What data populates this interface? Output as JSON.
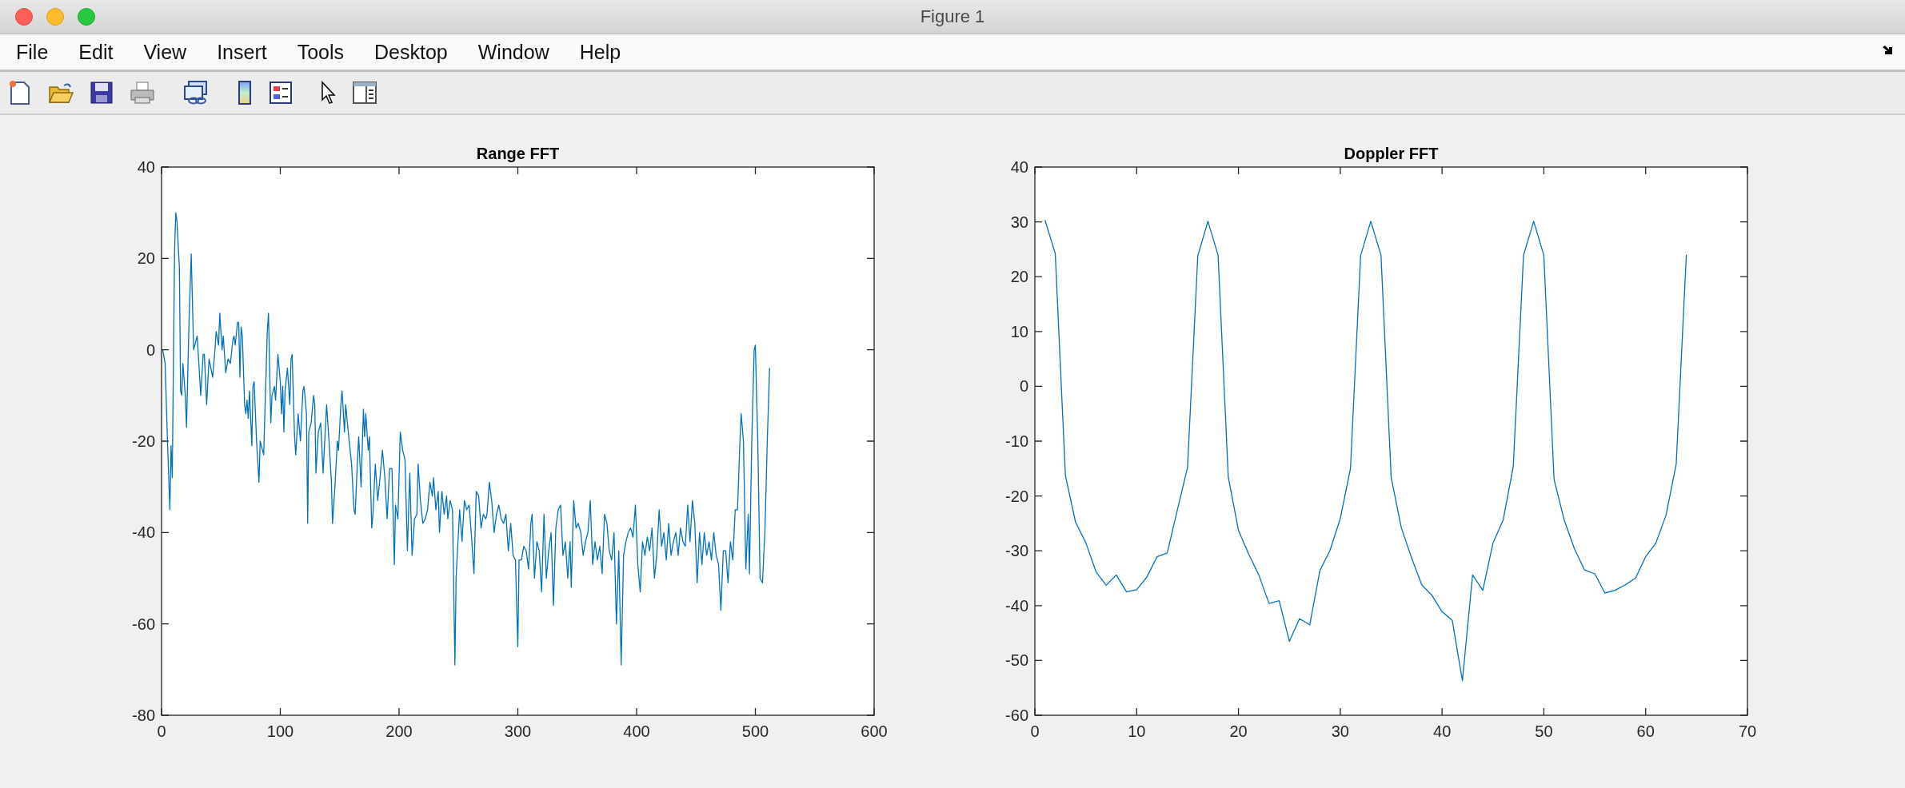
{
  "window": {
    "title": "Figure 1"
  },
  "menu": [
    "File",
    "Edit",
    "View",
    "Insert",
    "Tools",
    "Desktop",
    "Window",
    "Help"
  ],
  "toolbar": [
    {
      "kind": "new-file"
    },
    {
      "kind": "open"
    },
    {
      "kind": "save"
    },
    {
      "kind": "print"
    },
    {
      "kind": "link"
    },
    {
      "kind": "colorbar"
    },
    {
      "kind": "legend"
    },
    {
      "kind": "pointer"
    },
    {
      "kind": "panel"
    }
  ],
  "plots": [
    {
      "chart_data": {
        "type": "line",
        "title": "Range FFT",
        "xlim": [
          0,
          600
        ],
        "ylim": [
          -80,
          40
        ],
        "xticks": [
          0,
          100,
          200,
          300,
          400,
          500,
          600
        ],
        "yticks": [
          -80,
          -60,
          -40,
          -20,
          0,
          20,
          40
        ],
        "x": [
          1,
          3,
          5,
          7,
          8,
          9,
          11,
          12,
          13,
          15,
          16,
          17,
          18,
          20,
          21,
          23,
          25,
          27,
          29,
          30,
          33,
          35,
          36,
          38,
          40,
          43,
          45,
          46,
          48,
          49,
          51,
          52,
          54,
          56,
          58,
          60,
          61,
          62,
          64,
          65,
          66,
          67,
          68,
          70,
          71,
          72,
          73,
          74,
          76,
          77,
          78,
          80,
          82,
          83,
          85,
          86,
          89,
          90,
          92,
          93,
          95,
          96,
          98,
          100,
          101,
          102,
          103,
          104,
          106,
          108,
          109,
          110,
          112,
          113,
          115,
          117,
          119,
          120,
          122,
          123,
          124,
          126,
          128,
          129,
          130,
          132,
          134,
          136,
          138,
          139,
          141,
          143,
          144,
          146,
          148,
          149,
          151,
          152,
          154,
          155,
          158,
          160,
          162,
          163,
          165,
          166,
          168,
          170,
          171,
          172,
          174,
          175,
          177,
          178,
          180,
          182,
          184,
          186,
          188,
          190,
          192,
          194,
          196,
          197,
          199,
          201,
          203,
          205,
          207,
          209,
          211,
          213,
          215,
          216,
          218,
          220,
          222,
          224,
          226,
          228,
          229,
          231,
          233,
          234,
          236,
          238,
          240,
          241,
          243,
          245,
          247,
          248,
          251,
          253,
          255,
          257,
          259,
          261,
          263,
          265,
          267,
          269,
          271,
          273,
          274,
          276,
          278,
          280,
          282,
          284,
          286,
          288,
          290,
          292,
          294,
          296,
          298,
          300,
          301,
          303,
          305,
          307,
          309,
          311,
          312,
          314,
          316,
          318,
          320,
          322,
          324,
          326,
          328,
          330,
          332,
          334,
          336,
          338,
          340,
          342,
          344,
          345,
          347,
          349,
          351,
          353,
          355,
          357,
          359,
          361,
          363,
          365,
          367,
          369,
          371,
          373,
          375,
          377,
          379,
          381,
          383,
          385,
          387,
          389,
          391,
          393,
          395,
          397,
          399,
          401,
          403,
          405,
          407,
          409,
          411,
          413,
          415,
          417,
          419,
          421,
          423,
          425,
          427,
          429,
          431,
          433,
          435,
          437,
          439,
          441,
          443,
          445,
          447,
          449,
          451,
          453,
          455,
          457,
          459,
          461,
          463,
          465,
          467,
          469,
          471,
          473,
          475,
          477,
          479,
          481,
          483,
          485,
          487,
          488,
          490,
          492,
          494,
          495,
          497,
          499,
          500,
          502,
          504,
          506,
          508,
          510,
          512
        ],
        "series": [
          {
            "color": "#0072bd",
            "values": [
              0,
              -3,
              -20,
              -35,
              -21,
              -28,
              22,
              30,
              28,
              18,
              -9,
              -10,
              -3,
              -10,
              -17,
              5,
              21,
              0,
              2,
              3,
              -10,
              -1,
              -1,
              -12,
              -2,
              -6,
              0,
              4,
              1,
              8,
              0,
              3,
              -5,
              -2,
              -3,
              2,
              3,
              1,
              6,
              6,
              -6,
              5,
              3,
              -12,
              -14,
              -11,
              -15,
              -9,
              -21,
              -8,
              -7,
              -20,
              -29,
              -20,
              -22,
              -23,
              4,
              8,
              -16,
              -10,
              -8,
              -11,
              -1,
              -7,
              -14,
              -8,
              -18,
              -9,
              -4,
              -12,
              -2,
              -1,
              -19,
              -23,
              -14,
              -20,
              -9,
              -8,
              -14,
              -38,
              -18,
              -16,
              -10,
              -12,
              -27,
              -18,
              -16,
              -27,
              -17,
              -12,
              -20,
              -29,
              -38,
              -30,
              -20,
              -22,
              -12,
              -9,
              -18,
              -12,
              -20,
              -25,
              -35,
              -36,
              -24,
              -19,
              -30,
              -13,
              -19,
              -14,
              -22,
              -19,
              -39,
              -36,
              -25,
              -33,
              -28,
              -22,
              -28,
              -37,
              -26,
              -26,
              -47,
              -34,
              -37,
              -18,
              -22,
              -24,
              -44,
              -27,
              -45,
              -37,
              -36,
              -25,
              -33,
              -38,
              -37,
              -35,
              -29,
              -32,
              -28,
              -35,
              -31,
              -40,
              -31,
              -36,
              -32,
              -37,
              -33,
              -35,
              -69,
              -50,
              -35,
              -42,
              -33,
              -35,
              -34,
              -41,
              -49,
              -31,
              -32,
              -39,
              -36,
              -37,
              -36,
              -29,
              -33,
              -40,
              -36,
              -34,
              -37,
              -38,
              -36,
              -44,
              -38,
              -45,
              -46,
              -65,
              -46,
              -46,
              -43,
              -44,
              -48,
              -38,
              -36,
              -50,
              -42,
              -44,
              -53,
              -36,
              -50,
              -44,
              -40,
              -56,
              -39,
              -35,
              -34,
              -45,
              -42,
              -50,
              -42,
              -52,
              -33,
              -39,
              -38,
              -40,
              -45,
              -42,
              -40,
              -33,
              -47,
              -42,
              -46,
              -43,
              -49,
              -36,
              -38,
              -44,
              -46,
              -40,
              -60,
              -44,
              -69,
              -45,
              -42,
              -40,
              -39,
              -41,
              -34,
              -47,
              -53,
              -42,
              -45,
              -41,
              -44,
              -39,
              -50,
              -45,
              -35,
              -43,
              -40,
              -46,
              -38,
              -45,
              -42,
              -40,
              -45,
              -39,
              -42,
              -43,
              -34,
              -42,
              -33,
              -38,
              -51,
              -40,
              -47,
              -40,
              -45,
              -42,
              -46,
              -40,
              -45,
              -47,
              -57,
              -44,
              -44,
              -51,
              -42,
              -46,
              -35,
              -35,
              -20,
              -14,
              -20,
              -48,
              -36,
              -49,
              -20,
              0,
              1,
              -20,
              -50,
              -51,
              -40,
              -20,
              -4
            ]
          }
        ]
      }
    },
    {
      "chart_data": {
        "type": "line",
        "title": "Doppler FFT",
        "xlim": [
          0,
          70
        ],
        "ylim": [
          -60,
          40
        ],
        "xticks": [
          0,
          10,
          20,
          30,
          40,
          50,
          60,
          70
        ],
        "yticks": [
          -60,
          -50,
          -40,
          -30,
          -20,
          -10,
          0,
          10,
          20,
          30,
          40
        ],
        "x": [
          1,
          2,
          3,
          4,
          5,
          6,
          7,
          8,
          9,
          10,
          11,
          12,
          13,
          14,
          15,
          16,
          17,
          18,
          19,
          20,
          21,
          22,
          23,
          24,
          25,
          26,
          27,
          28,
          29,
          30,
          31,
          32,
          33,
          34,
          35,
          36,
          37,
          38,
          39,
          40,
          41,
          42,
          43,
          44,
          45,
          46,
          47,
          48,
          49,
          50,
          51,
          52,
          53,
          54,
          55,
          56,
          57,
          58,
          59,
          60,
          61,
          62,
          63,
          64
        ],
        "series": [
          {
            "color": "#0072bd",
            "values": [
              30.3,
              24.2,
              -16.3,
              -24.8,
              -28.5,
              -33.8,
              -36.3,
              -34.4,
              -37.5,
              -37.1,
              -34.8,
              -31.1,
              -30.4,
              -22.5,
              -14.8,
              23.8,
              30.1,
              23.9,
              -16.5,
              -26.3,
              -30.6,
              -34.4,
              -39.6,
              -39.1,
              -46.5,
              -42.4,
              -43.5,
              -33.6,
              -29.9,
              -24.1,
              -15.0,
              23.8,
              30.1,
              23.9,
              -16.6,
              -25.8,
              -31.3,
              -36.2,
              -38.1,
              -41.1,
              -42.7,
              -53.7,
              -34.4,
              -37.2,
              -28.6,
              -24.4,
              -14.6,
              23.9,
              30.1,
              23.9,
              -17.0,
              -24.4,
              -29.6,
              -33.5,
              -34.2,
              -37.7,
              -37.2,
              -36.2,
              -35.0,
              -31.1,
              -28.6,
              -23.5,
              -14.2,
              24.0
            ]
          }
        ]
      }
    }
  ]
}
